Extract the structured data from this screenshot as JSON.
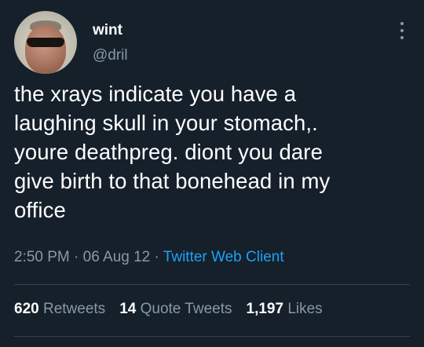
{
  "tweet": {
    "author": {
      "display_name": "wint",
      "handle": "@dril",
      "avatar": "avatar-photo"
    },
    "more_icon": "more-options-icon",
    "text": "the xrays indicate you have a\nlaughing skull in your stomach,.\nyoure deathpreg. diont you dare\ngive birth to that bonehead in my\noffice",
    "time": "2:50 PM",
    "separator": "·",
    "date": "06 Aug 12",
    "source": "Twitter Web Client",
    "stats": {
      "retweets_count": "620",
      "retweets_label": "Retweets",
      "quote_tweets_count": "14",
      "quote_tweets_label": "Quote Tweets",
      "likes_count": "1,197",
      "likes_label": "Likes"
    }
  },
  "colors": {
    "background": "#15202b",
    "text": "#ffffff",
    "secondary_text": "#8899a6",
    "link": "#1da1f2",
    "divider": "#38444d"
  }
}
